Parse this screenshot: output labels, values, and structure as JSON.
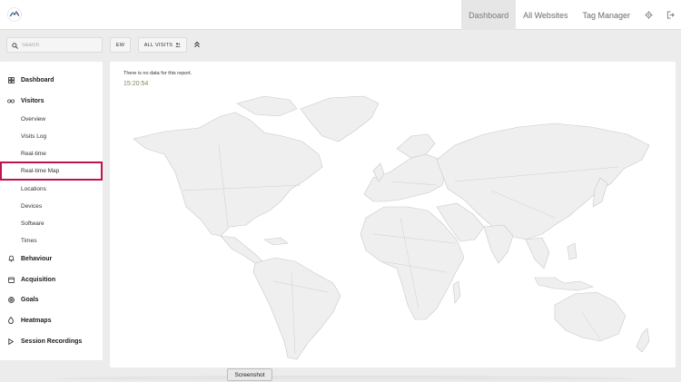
{
  "header": {
    "nav": [
      {
        "label": "Dashboard",
        "active": true
      },
      {
        "label": "All Websites",
        "active": false
      },
      {
        "label": "Tag Manager",
        "active": false
      }
    ],
    "icons": [
      "gear-icon",
      "logout-icon"
    ]
  },
  "toolbar": {
    "search_placeholder": "Search",
    "period_label": "EW",
    "segment_label": "ALL VISITS",
    "collapse_icon": "double-chevron-up-icon"
  },
  "sidebar": {
    "groups": [
      {
        "label": "Dashboard",
        "icon": "dashboard-grid-icon"
      },
      {
        "label": "Visitors",
        "icon": "visitors-icon"
      },
      {
        "label": "Behaviour",
        "icon": "bell-icon"
      },
      {
        "label": "Acquisition",
        "icon": "acquisition-icon"
      },
      {
        "label": "Goals",
        "icon": "target-icon"
      },
      {
        "label": "Heatmaps",
        "icon": "flame-icon"
      },
      {
        "label": "Session Recordings",
        "icon": "play-icon"
      }
    ],
    "visitors_items": [
      {
        "label": "Overview"
      },
      {
        "label": "Visits Log"
      },
      {
        "label": "Real-time"
      },
      {
        "label": "Real-time Map",
        "active": true
      },
      {
        "label": "Locations"
      },
      {
        "label": "Devices"
      },
      {
        "label": "Software"
      },
      {
        "label": "Times"
      }
    ]
  },
  "main": {
    "no_data_message": "There is no data for this report.",
    "time": "15:20:54"
  },
  "tooltip": {
    "label": "Screenshot"
  },
  "colors": {
    "active_highlight": "#c0134a",
    "time_text": "#7d8a58",
    "map_land": "#efefef",
    "map_border": "#c9c9c9"
  }
}
